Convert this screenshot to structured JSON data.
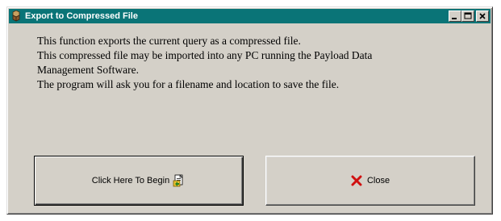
{
  "window": {
    "title": "Export to Compressed File",
    "title_bar_color": "#0a7477",
    "icons": [
      "app-icon",
      "minimize-icon",
      "maximize-icon",
      "close-icon"
    ]
  },
  "message": {
    "lines": [
      "This function exports the current query as a compressed file.",
      "This compressed file may be imported into any PC running the Payload Data",
      "Management Software.",
      "The program will ask you for a filename and location to save the file."
    ]
  },
  "buttons": {
    "begin_label": "Click Here To Begin",
    "begin_icon": "file-export-icon",
    "close_label": "Close",
    "close_icon": "red-x-icon"
  }
}
